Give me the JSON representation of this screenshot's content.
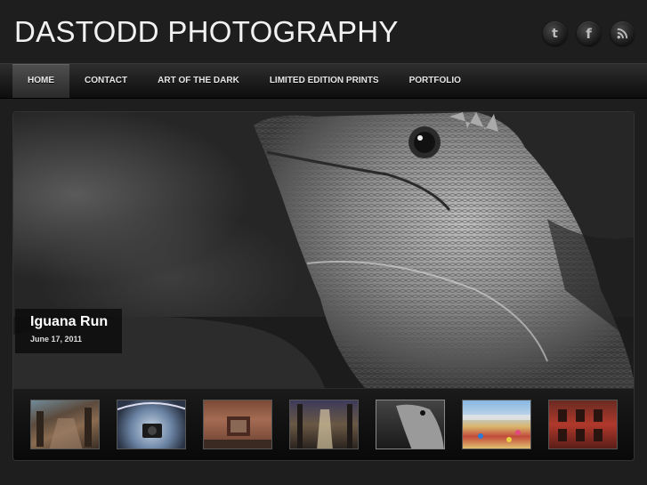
{
  "site": {
    "title": "DASTODD PHOTOGRAPHY"
  },
  "social": [
    {
      "name": "twitter",
      "icon": "twitter-icon",
      "glyph": "t"
    },
    {
      "name": "facebook",
      "icon": "facebook-icon",
      "glyph": "f"
    },
    {
      "name": "rss",
      "icon": "rss-icon"
    }
  ],
  "nav": {
    "items": [
      {
        "label": "HOME",
        "active": true
      },
      {
        "label": "CONTACT",
        "active": false
      },
      {
        "label": "ART OF THE DARK",
        "active": false
      },
      {
        "label": "LIMITED EDITION PRINTS",
        "active": false
      },
      {
        "label": "PORTFOLIO",
        "active": false
      }
    ]
  },
  "slider": {
    "current": {
      "title": "Iguana Run",
      "date": "June 17, 2011"
    },
    "thumbnails": [
      {
        "subject": "ruined-cathedral-interior"
      },
      {
        "subject": "camera-reflection-sculpture"
      },
      {
        "subject": "derelict-red-room"
      },
      {
        "subject": "cathedral-nave"
      },
      {
        "subject": "iguana-bw",
        "selected": true
      },
      {
        "subject": "crowded-beach"
      },
      {
        "subject": "red-brick-building"
      }
    ]
  },
  "colors": {
    "background": "#1e1e1e",
    "nav_active": "#4a4a4a",
    "text": "#f2f2f2"
  }
}
